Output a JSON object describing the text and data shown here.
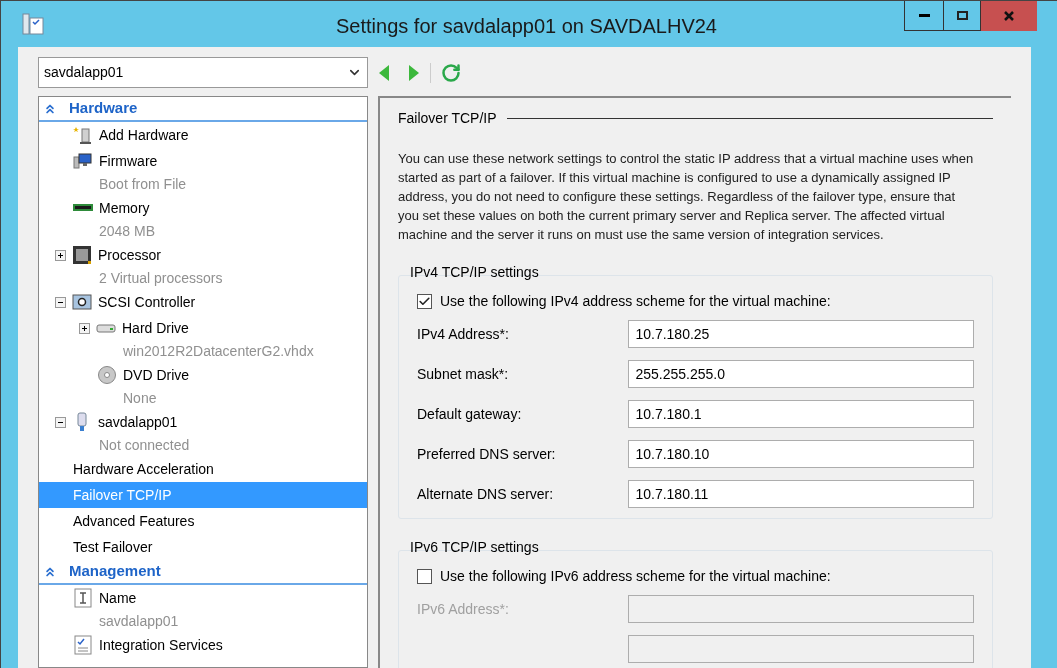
{
  "window": {
    "title": "Settings for savdalapp01 on SAVDALHV24"
  },
  "vm_selector": {
    "value": "savdalapp01"
  },
  "tree": [
    {
      "name": "Hardware",
      "expanded": true,
      "children": [
        {
          "kind": "hardware",
          "name": "Add Hardware",
          "selected": false
        },
        {
          "kind": "firmware",
          "name": "Firmware",
          "detail": "Boot from File",
          "selected": false
        },
        {
          "kind": "memory",
          "name": "Memory",
          "detail": "2048 MB",
          "selected": false
        },
        {
          "kind": "processor",
          "name": "Processor",
          "detail": "2 Virtual processors",
          "expanded": false,
          "selected": false
        },
        {
          "kind": "controller",
          "name": "SCSI Controller",
          "expanded": true,
          "selected": false,
          "children": [
            {
              "kind": "disk",
              "name": "Hard Drive",
              "detail": "win2012R2DatacenterG2.vhdx",
              "expanded": false,
              "selected": false
            },
            {
              "kind": "dvd",
              "name": "DVD Drive",
              "detail": "None",
              "selected": false
            }
          ]
        },
        {
          "kind": "network",
          "name": "savdalapp01",
          "detail": "Not connected",
          "expanded": true,
          "selected": false,
          "children": [
            {
              "kind": "setting",
              "name": "Hardware Acceleration",
              "selected": false
            },
            {
              "kind": "setting",
              "name": "Failover TCP/IP",
              "selected": true
            },
            {
              "kind": "setting",
              "name": "Advanced Features",
              "selected": false
            },
            {
              "kind": "setting",
              "name": "Test Failover",
              "selected": false
            }
          ]
        }
      ]
    },
    {
      "name": "Management",
      "expanded": true,
      "children": [
        {
          "kind": "name",
          "name": "Name",
          "detail": "savdalapp01",
          "selected": false
        },
        {
          "kind": "integration",
          "name": "Integration Services",
          "selected": false
        }
      ]
    }
  ],
  "panel": {
    "title": "Failover TCP/IP",
    "description": "You can use these network settings to control the static IP address that a virtual machine uses when started as part of a failover. If this virtual machine is configured to use a dynamically assigned IP address, you do not need to configure these settings. Regardless of the failover type, ensure that you set these values on both the current primary server and Replica server. The affected virtual machine and the server it runs on must use the same version of integration services.",
    "groups": [
      {
        "title": "IPv4 TCP/IP settings",
        "checkbox": {
          "label": "Use the following IPv4 address scheme for the virtual machine:",
          "checked": true
        },
        "fields": [
          {
            "label": "IPv4 Address*:",
            "value": "10.7.180.25",
            "disabled": false
          },
          {
            "label": "Subnet mask*:",
            "value": "255.255.255.0",
            "disabled": false
          },
          {
            "label": "Default gateway:",
            "value": "10.7.180.1",
            "disabled": false
          },
          {
            "label": "Preferred DNS server:",
            "value": "10.7.180.10",
            "disabled": false
          },
          {
            "label": "Alternate DNS server:",
            "value": "10.7.180.11",
            "disabled": false
          }
        ]
      },
      {
        "title": "IPv6 TCP/IP settings",
        "checkbox": {
          "label": "Use the following IPv6 address scheme for the virtual machine:",
          "checked": false
        },
        "fields": [
          {
            "label": "IPv6 Address*:",
            "disabled": true
          },
          {
            "disabled": true
          }
        ]
      }
    ]
  }
}
